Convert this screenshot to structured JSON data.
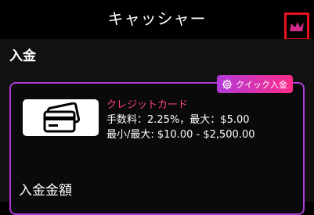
{
  "header": {
    "title": "キャッシャー"
  },
  "section": {
    "deposit_title": "入金"
  },
  "payment_method": {
    "badge_label": "クイック入金",
    "name": "クレジットカード",
    "fee_line": "手数料：2.25%，最大：$5.00",
    "limit_line": "最小/最大: $10.00 - $2,500.00"
  },
  "amount": {
    "title": "入金金額"
  },
  "colors": {
    "accent_pink": "#ff3b8d",
    "accent_purple": "#b23bd8",
    "highlight_red": "#e8131d"
  },
  "icons": {
    "close": "crown-icon",
    "badge": "gear-icon",
    "card": "credit-card-icon"
  }
}
